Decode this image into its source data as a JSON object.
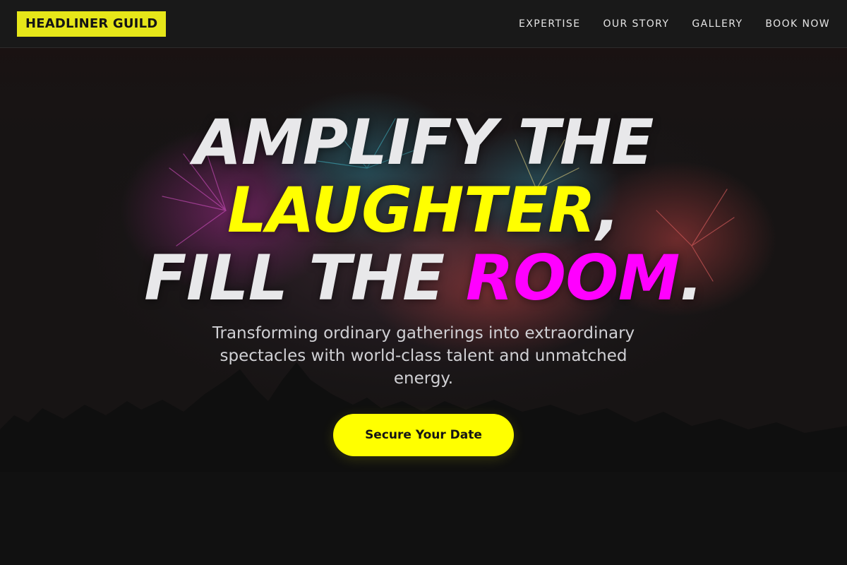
{
  "brand": {
    "name": "HEADLINER GUILD",
    "accent_color": "#e6e619"
  },
  "nav": {
    "items": [
      {
        "label": "EXPERTISE"
      },
      {
        "label": "OUR STORY"
      },
      {
        "label": "GALLERY"
      },
      {
        "label": "BOOK NOW"
      }
    ]
  },
  "hero": {
    "headline": {
      "line1": "AMPLIFY THE",
      "line2_highlight": "LAUGHTER",
      "line2_punct": ",",
      "line3_prefix": "FILL THE ",
      "line3_highlight": "ROOM",
      "line3_punct": "."
    },
    "subtitle": "Transforming ordinary gatherings into extraordinary spectacles with world-class talent and unmatched energy.",
    "cta_label": "Secure Your Date",
    "background_image": "fireworks-crowd-silhouette",
    "colors": {
      "headline": "#e8e8ea",
      "highlight_yellow": "#ffff00",
      "highlight_magenta": "#ff00ff",
      "cta_background": "#ffff00"
    }
  }
}
